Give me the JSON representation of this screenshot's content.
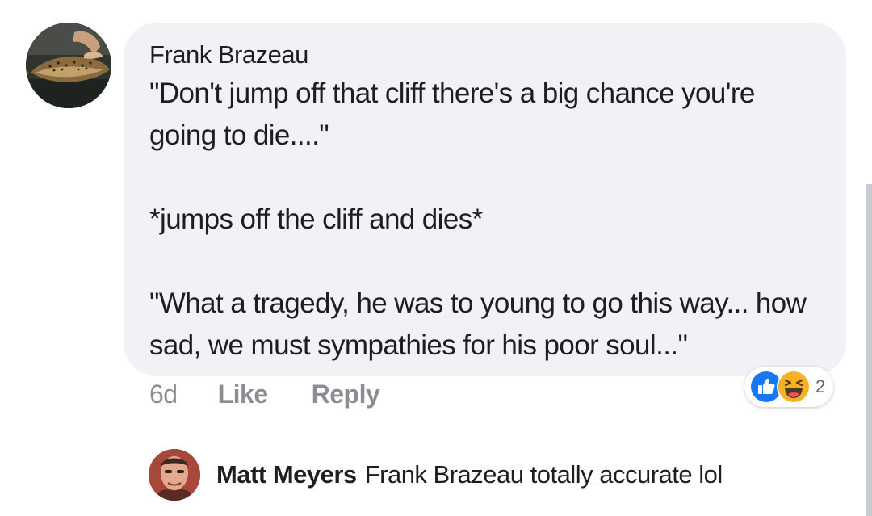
{
  "comment": {
    "author": "Frank Brazeau",
    "text": "\"Don't jump off that cliff there's a big chance you're going to die....\"\n\n*jumps off the cliff and dies*\n\n\"What a tragedy, he was to young to go this way... how sad, we must sympathies for his poor soul...\"",
    "time": "6d",
    "like_label": "Like",
    "reply_label": "Reply",
    "reactions": {
      "icons": [
        "like-reaction",
        "haha-reaction"
      ],
      "count": "2"
    }
  },
  "reply": {
    "author": "Matt Meyers",
    "text": "Frank Brazeau totally accurate lol"
  },
  "colors": {
    "bubble": "#f0f2f5",
    "meta_text": "#8a8d91",
    "like_blue": "#1877f2",
    "haha_yellow": "#f7b125"
  }
}
